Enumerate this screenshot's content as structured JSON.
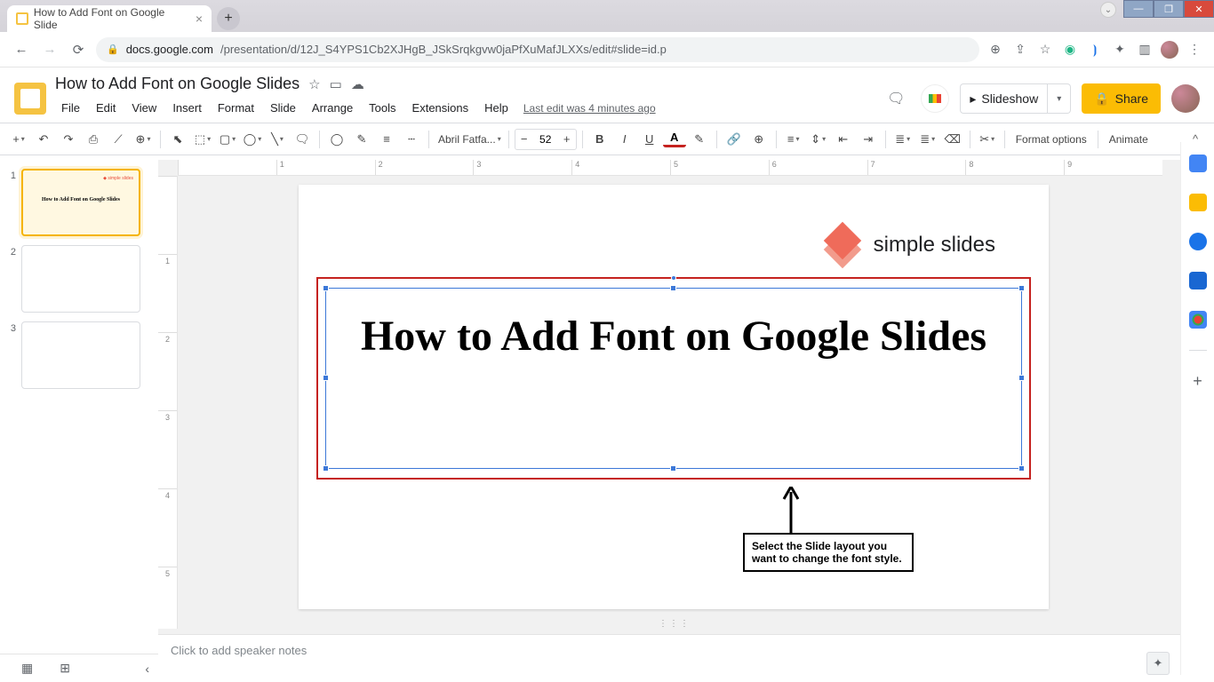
{
  "tab": {
    "title": "How to Add Font on Google Slide",
    "close": "×",
    "new": "+"
  },
  "window": {
    "min": "—",
    "max": "❐",
    "close": "✕",
    "restore_arrow": "⌄"
  },
  "nav": {
    "back": "←",
    "forward": "→",
    "reload": "⟳"
  },
  "url": {
    "lock": "🔒",
    "host": "docs.google.com",
    "path": "/presentation/d/12J_S4YPS1Cb2XJHgB_JSkSrqkgvw0jaPfXuMafJLXXs/edit#slide=id.p"
  },
  "addr_icons": {
    "search": "⊕",
    "share": "⇪",
    "star": "☆",
    "green": "◉",
    "cast": "⦘",
    "puzzle": "✦",
    "panel": "▥",
    "menu": "⋮"
  },
  "header": {
    "title": "How to Add Font on  Google Slides",
    "star": "☆",
    "move": "▭",
    "cloud": "☁",
    "comments": "🗨",
    "meet_icon": "▮",
    "slideshow_icon": "▸",
    "slideshow": "Slideshow",
    "slideshow_drop": "▾",
    "share_icon": "🔒",
    "share": "Share"
  },
  "menu": {
    "items": [
      "File",
      "Edit",
      "View",
      "Insert",
      "Format",
      "Slide",
      "Arrange",
      "Tools",
      "Extensions",
      "Help"
    ],
    "last_edit": "Last edit was 4 minutes ago"
  },
  "toolbar": {
    "new_slide": "+",
    "undo": "↶",
    "redo": "↷",
    "print": "⎙",
    "paint": "⟋",
    "zoom": "⊕",
    "select": "⬉",
    "textbox": "⬚",
    "image": "▢",
    "shape": "◯",
    "line": "╲",
    "comment": "🗨",
    "fill": "◯",
    "border_color": "✎",
    "border_weight": "≡",
    "border_dash": "┄",
    "font": "Abril Fatfa...",
    "font_drop": "▾",
    "size_minus": "−",
    "size": "52",
    "size_plus": "+",
    "bold": "B",
    "italic": "I",
    "underline": "U",
    "text_color": "A",
    "highlight": "✎",
    "link": "🔗",
    "add_comment": "⊕",
    "align": "≡",
    "line_spacing": "⇕",
    "indent_dec": "⇤",
    "indent_inc": "⇥",
    "list_bullet": "≣",
    "list_number": "≣",
    "clear": "⌫",
    "mask": "✂",
    "format_options": "Format options",
    "animate": "Animate",
    "collapse": "^"
  },
  "ruler_h": [
    "",
    "1",
    "2",
    "3",
    "4",
    "5",
    "6",
    "7",
    "8",
    "9"
  ],
  "ruler_v": [
    "",
    "1",
    "2",
    "3",
    "4",
    "5"
  ],
  "filmstrip": {
    "slides": [
      {
        "num": "1",
        "selected": true,
        "preview_title": "How to Add Font on\nGoogle Slides",
        "logo": "◆ simple slides"
      },
      {
        "num": "2",
        "selected": false,
        "preview_title": "",
        "logo": ""
      },
      {
        "num": "3",
        "selected": false,
        "preview_title": "",
        "logo": ""
      }
    ]
  },
  "slide": {
    "brand_text": "simple slides",
    "title": "How to Add Font on Google Slides",
    "callout": "Select the Slide layout you want to change the font style."
  },
  "speaker": {
    "placeholder": "Click to add speaker notes"
  },
  "bottom": {
    "filmstrip_view": "▦",
    "grid_view": "⊞",
    "collapse": "‹"
  },
  "explore": {
    "icon": "✦",
    "arrow": "›"
  },
  "drag": {
    "dots": "⋮⋮⋮"
  }
}
